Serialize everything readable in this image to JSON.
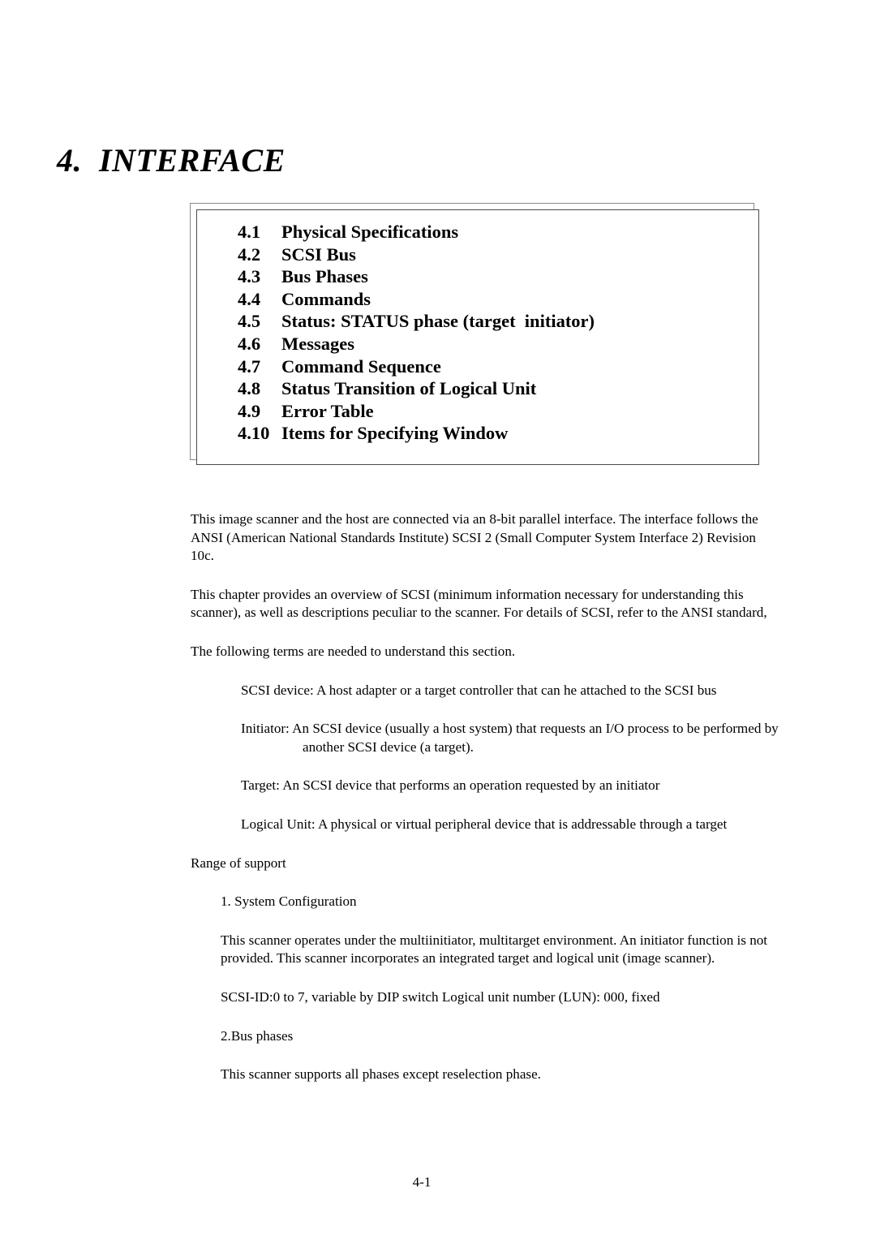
{
  "document": {
    "chapter_title": "4.  INTERFACE",
    "page_number": "4-1"
  },
  "toc": {
    "entries": [
      {
        "number": "4.1",
        "label": "Physical Specifications"
      },
      {
        "number": "4.2",
        "label": "SCSI Bus"
      },
      {
        "number": "4.3",
        "label": "Bus Phases"
      },
      {
        "number": "4.4",
        "label": "Commands"
      },
      {
        "number": "4.5",
        "label": "Status: STATUS phase (target  initiator)"
      },
      {
        "number": "4.6",
        "label": "Messages"
      },
      {
        "number": "4.7",
        "label": "Command Sequence"
      },
      {
        "number": "4.8",
        "label": "Status Transition of Logical Unit"
      },
      {
        "number": "4.9",
        "label": "Error Table"
      },
      {
        "number": "4.10",
        "label": "Items for Specifying Window"
      }
    ]
  },
  "body": {
    "intro_paragraph_1": "This image scanner and the host are connected via an 8-bit parallel interface. The interface follows the ANSI (American National Standards Institute) SCSI 2 (Small Computer System Interface 2) Revision 10c.",
    "intro_paragraph_2": "This chapter provides an overview of SCSI (minimum information necessary for understanding this scanner), as well as descriptions peculiar to the scanner. For details of SCSI, refer to the ANSI standard,",
    "terms_lead_in": "The following terms are needed to understand this section.",
    "definitions": [
      {
        "term": "SCSI device:",
        "text": "A host adapter or a target controller that can he attached to the SCSI bus",
        "continuation": ""
      },
      {
        "term": "Initiator:",
        "text": "An SCSI device (usually a host system) that requests an I/O process to be performed by",
        "continuation": "another SCSI device (a target)."
      },
      {
        "term": "Target:",
        "text": "An SCSI device that performs an operation requested by an initiator",
        "continuation": ""
      },
      {
        "term": "Logical Unit:",
        "text": "A physical or virtual peripheral device that is addressable through a target",
        "continuation": ""
      }
    ],
    "range_of_support_heading": "Range of support",
    "section_1_heading": "1. System Configuration",
    "section_1_paragraph": "This scanner operates under the multiinitiator, multitarget environment. An initiator function is not provided. This scanner incorporates an integrated target and logical unit (image scanner).",
    "scsi_id_line": "SCSI-ID:0 to 7, variable by DIP switch Logical unit number (LUN): 000, fixed",
    "section_2_heading": "2.Bus phases",
    "section_2_paragraph": "This scanner supports all phases except reselection phase."
  }
}
